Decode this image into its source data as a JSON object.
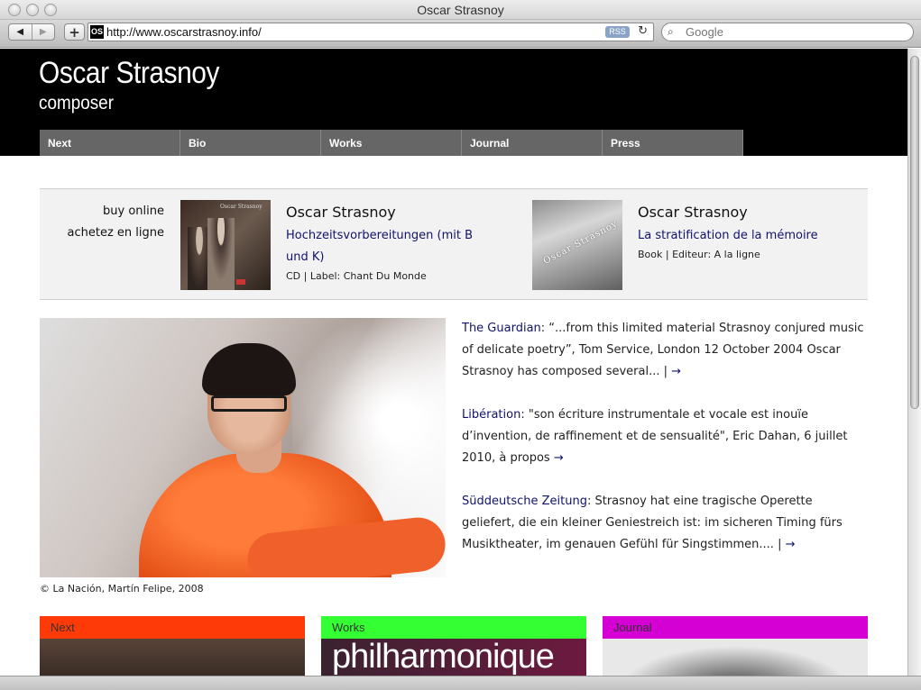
{
  "browser": {
    "window_title": "Oscar Strasnoy",
    "url": "http://www.oscarstrasnoy.info/",
    "favicon_text": "OS",
    "rss_label": "RSS",
    "search_placeholder": "Google",
    "back_icon": "◀",
    "forward_icon": "▶",
    "add_icon": "+",
    "reload_icon": "↻",
    "search_icon": "⌕"
  },
  "header": {
    "name": "Oscar Strasnoy",
    "role": "composer"
  },
  "nav": [
    "Next",
    "Bio",
    "Works",
    "Journal",
    "Press"
  ],
  "buy": {
    "label1": "buy online",
    "label2": "achetez en ligne",
    "products": [
      {
        "title": "Oscar Strasnoy",
        "link": "Hochzeitsvorbereitungen (mit B und K)",
        "meta": "CD | Label: Chant Du Monde",
        "cover_text": "Oscar Strasnoy"
      },
      {
        "title": "Oscar Strasnoy",
        "link": "La stratification de la mémoire",
        "meta": "Book | Editeur: A la ligne",
        "cover_text": "Oscar Strasnoy"
      }
    ]
  },
  "photo_credit": "© La Nación, Martín Felipe, 2008",
  "quotes": [
    {
      "source": "The Guardian",
      "text": ": “...from this limited material Strasnoy conjured music of delicate poetry”, Tom Service, London 12 October 2004 Oscar Strasnoy has composed several... | ",
      "arrow": "→"
    },
    {
      "source": "Libération",
      "text": ": \"son écriture instrumentale et vocale est inouïe d’invention, de raffinement et de sensualité\", Eric Dahan, 6 juillet 2010, à propos ",
      "arrow": "→"
    },
    {
      "source": "Süddeutsche Zeitung",
      "text": ": Strasnoy hat eine tragische Operette geliefert, die ein kleiner Geniestreich ist: im sicheren Timing fürs Musiktheater, im genauen Gefühl für Singstimmen.... | ",
      "arrow": "→"
    }
  ],
  "cards": [
    {
      "label": "Next",
      "color": "#ff3a09"
    },
    {
      "label": "Works",
      "color": "#33ff33",
      "image_text": "philharmonique"
    },
    {
      "label": "Journal",
      "color": "#d400d4"
    }
  ]
}
